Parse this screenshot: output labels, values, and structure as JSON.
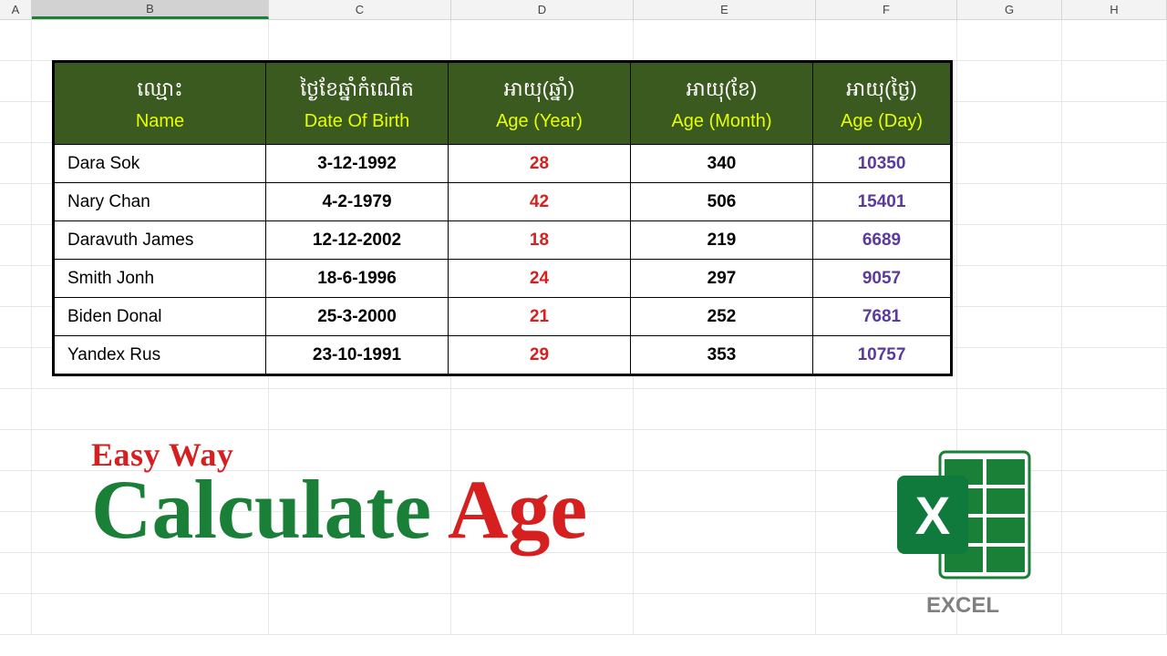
{
  "columns": [
    "A",
    "B",
    "C",
    "D",
    "E",
    "F",
    "G",
    "H"
  ],
  "selected_column": "B",
  "table": {
    "headers": [
      {
        "khmer": "ឈ្មោះ",
        "eng": "Name"
      },
      {
        "khmer": "ថ្ងៃខែឆ្នាំកំណើត",
        "eng": "Date Of Birth"
      },
      {
        "khmer": "អាយុ(ឆ្នាំ)",
        "eng": "Age (Year)"
      },
      {
        "khmer": "អាយុ(ខែ)",
        "eng": "Age (Month)"
      },
      {
        "khmer": "អាយុ(ថ្ងៃ)",
        "eng": "Age (Day)"
      }
    ],
    "rows": [
      {
        "name": "Dara Sok",
        "dob": "3-12-1992",
        "year": "28",
        "month": "340",
        "day": "10350"
      },
      {
        "name": "Nary Chan",
        "dob": "4-2-1979",
        "year": "42",
        "month": "506",
        "day": "15401"
      },
      {
        "name": "Daravuth James",
        "dob": "12-12-2002",
        "year": "18",
        "month": "219",
        "day": "6689"
      },
      {
        "name": "Smith Jonh",
        "dob": "18-6-1996",
        "year": "24",
        "month": "297",
        "day": "9057"
      },
      {
        "name": "Biden Donal",
        "dob": "25-3-2000",
        "year": "21",
        "month": "252",
        "day": "7681"
      },
      {
        "name": "Yandex Rus",
        "dob": "23-10-1991",
        "year": "29",
        "month": "353",
        "day": "10757"
      }
    ]
  },
  "title": {
    "small": "Easy Way",
    "big1": "Calculate ",
    "big2": "Age"
  },
  "logo_label": "EXCEL"
}
